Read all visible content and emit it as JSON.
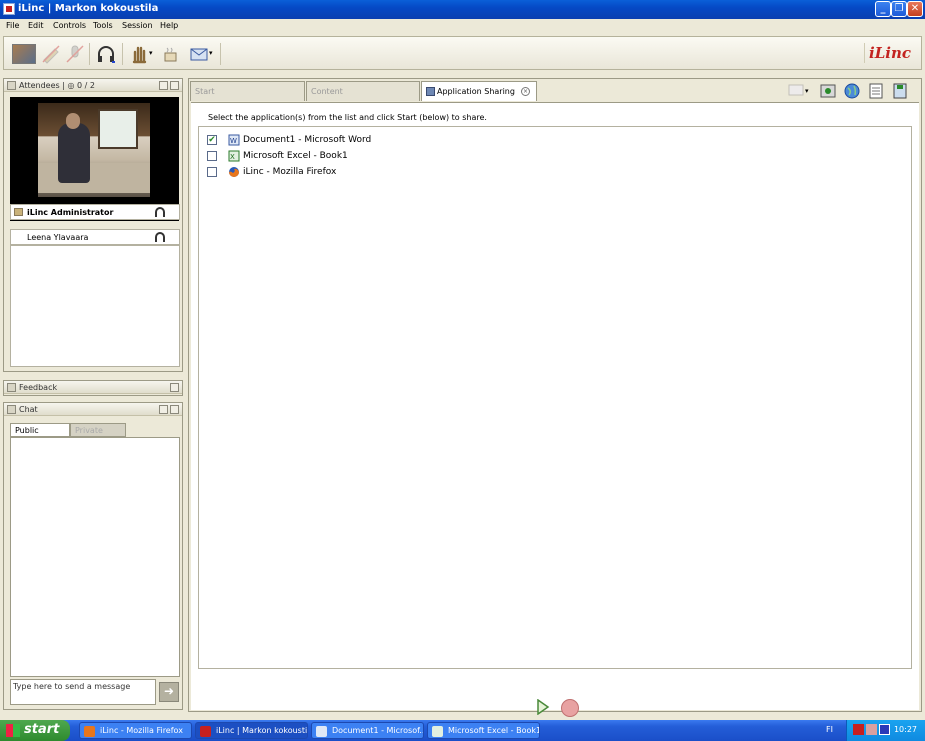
{
  "window": {
    "title": "iLinc | Markon kokoustila"
  },
  "menu": [
    "File",
    "Edit",
    "Controls",
    "Tools",
    "Session",
    "Help"
  ],
  "toolbar": {
    "logo": "iLinc"
  },
  "attendees": {
    "title": "Attendees",
    "count": "0 / 2",
    "presenter": "iLinc Administrator",
    "participants": [
      "Leena Ylavaara"
    ]
  },
  "feedback": {
    "title": "Feedback"
  },
  "chat": {
    "title": "Chat",
    "tab_public": "Public",
    "tab_private": "Private",
    "input_placeholder": "Type here to send a message"
  },
  "tabs": [
    {
      "label": "Start",
      "active": false
    },
    {
      "label": "Content",
      "active": false
    },
    {
      "label": "Application Sharing",
      "active": true
    }
  ],
  "app_sharing": {
    "instruction": "Select the application(s) from the list and click Start (below) to share.",
    "apps": [
      {
        "label": "Document1 - Microsoft Word",
        "checked": true,
        "icon": "word-icon"
      },
      {
        "label": "Microsoft Excel - Book1",
        "checked": false,
        "icon": "excel-icon"
      },
      {
        "label": "iLinc - Mozilla Firefox",
        "checked": false,
        "icon": "firefox-icon"
      }
    ]
  },
  "taskbar": {
    "start": "start",
    "tasks": [
      {
        "label": "iLinc - Mozilla Firefox",
        "active": false
      },
      {
        "label": "iLinc | Markon kokoustila",
        "active": true
      },
      {
        "label": "Document1 - Microsof...",
        "active": false
      },
      {
        "label": "Microsoft Excel - Book1",
        "active": false
      }
    ],
    "language": "FI",
    "clock": "10:27"
  }
}
